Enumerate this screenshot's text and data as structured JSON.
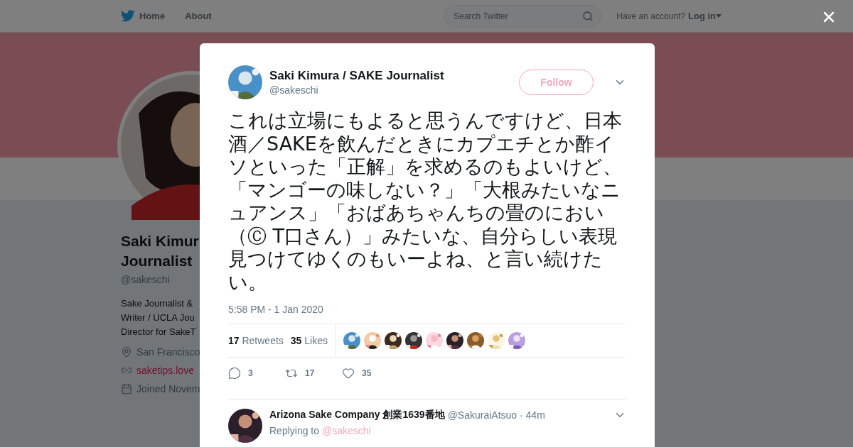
{
  "nav": {
    "items": [
      {
        "label": "Home",
        "kind": "home"
      },
      {
        "label": "About",
        "kind": "plain"
      }
    ],
    "search": {
      "placeholder": "Search Twitter"
    },
    "account_prompt": "Have an account?",
    "login": "Log in"
  },
  "profile": {
    "name_lines": [
      "Saki Kimur",
      "Journalist"
    ],
    "handle": "@sakeschi",
    "bio_lines": [
      "Sake Journalist &",
      "Writer / UCLA Jou",
      "Director for SakeT"
    ],
    "details": [
      {
        "kind": "location",
        "text": "San Francisco"
      },
      {
        "kind": "link",
        "text": "saketips.love"
      },
      {
        "kind": "joined",
        "text": "Joined Novem"
      }
    ]
  },
  "tweet": {
    "author": "Saki Kimura / SAKE Journalist",
    "handle": "@sakeschi",
    "follow": "Follow",
    "text": "これは立場にもよると思うんですけど、日本酒／SAKEを飲んだときにカプエチとか酢イソといった「正解」を求めるのもよいけど、「マンゴーの味しない？」「大根みたいなニュアンス」「おばあちゃんちの畳のにおい（Ⓒ T口さん）」みたいな、自分らしい表現見つけてゆくのもいーよね、と言い続けたい。",
    "time": "5:58 PM - 1 Jan 2020",
    "stats": [
      {
        "count": "17",
        "label": "Retweets"
      },
      {
        "count": "35",
        "label": "Likes"
      }
    ],
    "actions": [
      {
        "kind": "reply",
        "count": "3"
      },
      {
        "kind": "retweet",
        "count": "17"
      },
      {
        "kind": "like",
        "count": "35"
      }
    ]
  },
  "reply": {
    "author": "Arizona Sake Company 創業1639番地",
    "handle": "@SakuraiAtsuo",
    "separator": "·",
    "time": "44m",
    "replying_label": "Replying to",
    "replying_to": "@sakeschi"
  }
}
